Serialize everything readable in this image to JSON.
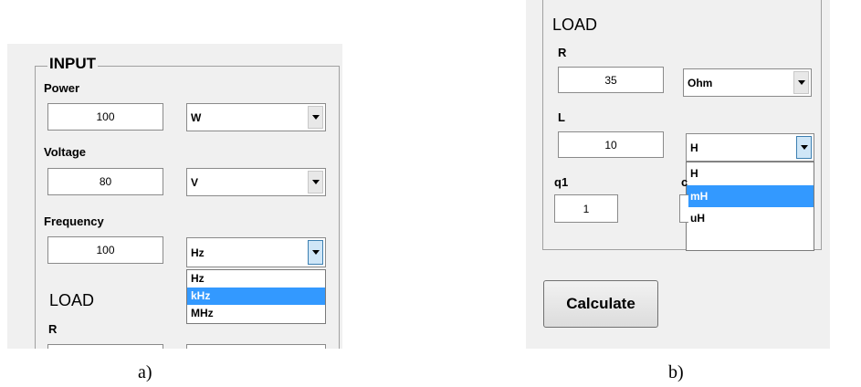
{
  "panel_a": {
    "input_group_title": "INPUT",
    "power": {
      "label": "Power",
      "value": "100",
      "unit": "W"
    },
    "voltage": {
      "label": "Voltage",
      "value": "80",
      "unit": "V"
    },
    "frequency": {
      "label": "Frequency",
      "value": "100",
      "unit": "Hz",
      "options": [
        "Hz",
        "kHz",
        "MHz"
      ],
      "highlighted": "kHz"
    },
    "load_title": "LOAD",
    "r_label": "R"
  },
  "panel_b": {
    "load_title": "LOAD",
    "r": {
      "label": "R",
      "value": "35",
      "unit": "Ohm"
    },
    "l": {
      "label": "L",
      "value": "10",
      "unit": "H",
      "options": [
        "H",
        "mH",
        "uH"
      ],
      "highlighted": "mH"
    },
    "q1": {
      "label": "q1",
      "value": "1"
    },
    "q2_label_partial": "c",
    "calculate_label": "Calculate"
  },
  "captions": {
    "a": "a)",
    "b": "b)"
  },
  "colors": {
    "panel_bg": "#f0f0f0",
    "selection": "#3399ff",
    "border": "#a0a0a0"
  }
}
